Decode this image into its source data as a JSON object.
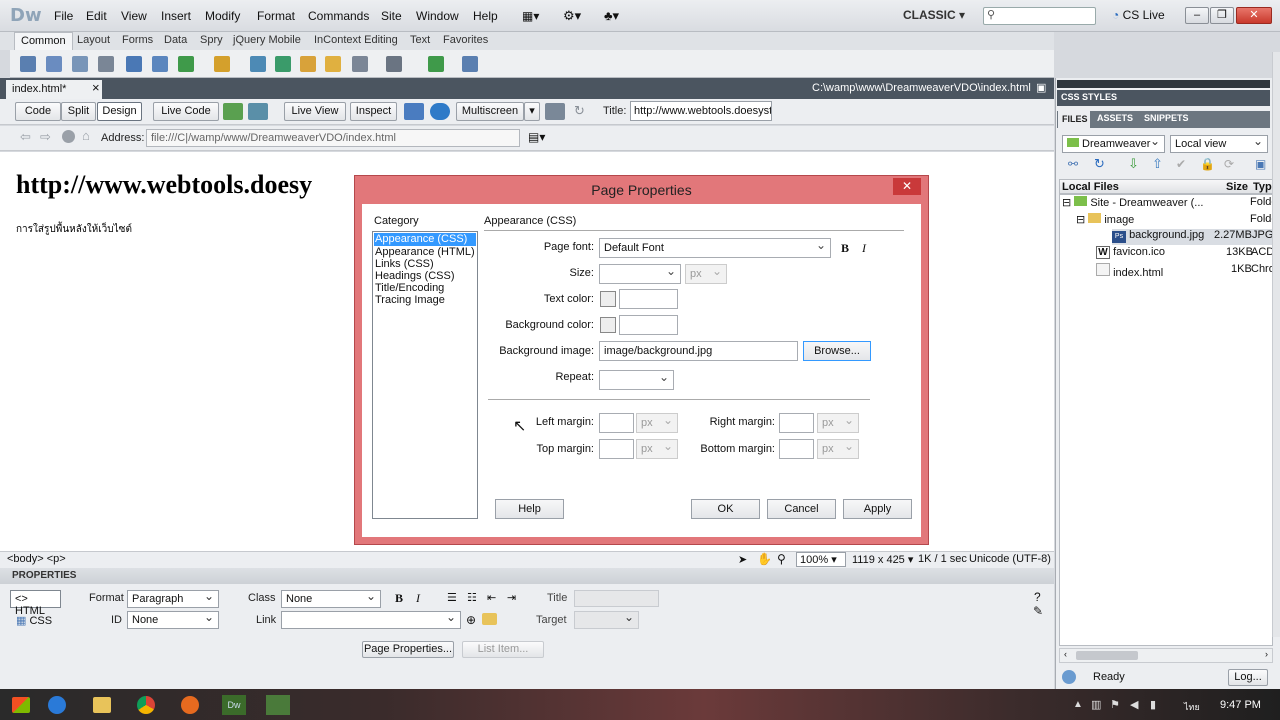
{
  "app": {
    "logo": "Dw",
    "menus": [
      "File",
      "Edit",
      "View",
      "Insert",
      "Modify",
      "Format",
      "Commands",
      "Site",
      "Window",
      "Help"
    ],
    "workspace": "CLASSIC",
    "cslive": "CS Live",
    "win_min": "–",
    "win_max": "❐",
    "win_close": "✕"
  },
  "insert_tabs": [
    "Common",
    "Layout",
    "Forms",
    "Data",
    "Spry",
    "jQuery Mobile",
    "InContext Editing",
    "Text",
    "Favorites"
  ],
  "document": {
    "tab": "index.html*",
    "tab_close": "×",
    "path": "C:\\wamp\\www\\DreamweaverVDO\\index.html",
    "view_buttons": {
      "code": "Code",
      "split": "Split",
      "design": "Design",
      "live_code": "Live Code",
      "live_view": "Live View",
      "inspect": "Inspect",
      "multiscreen": "Multiscreen"
    },
    "title_label": "Title:",
    "title_value": "http://www.webtools.doesyst",
    "address_label": "Address:",
    "address_value": "file:///C|/wamp/www/DreamweaverVDO/index.html"
  },
  "canvas": {
    "heading": "http://www.webtools.doesy",
    "text": "การใส่รูปพื้นหลังให้เว็บไซต์"
  },
  "status": {
    "tag": "<body> <p>",
    "zoom": "100%",
    "size": "1119 x 425",
    "dl": "1K / 1 sec",
    "encoding": "Unicode (UTF-8)"
  },
  "properties": {
    "header": "PROPERTIES",
    "html": "HTML",
    "css": "CSS",
    "format_label": "Format",
    "format_value": "Paragraph",
    "class_label": "Class",
    "class_value": "None",
    "id_label": "ID",
    "id_value": "None",
    "link_label": "Link",
    "title_label": "Title",
    "target_label": "Target",
    "bold": "B",
    "italic": "I",
    "page_props_btn": "Page Properties...",
    "list_item_btn": "List Item..."
  },
  "right_panel": {
    "css_styles": "CSS STYLES",
    "tabs": [
      "FILES",
      "ASSETS",
      "SNIPPETS"
    ],
    "site": "Dreamweaver",
    "view": "Local view",
    "col_local": "Local Files",
    "col_size": "Size",
    "col_type": "Typ",
    "files": [
      {
        "name": "Site - Dreamweaver (...",
        "size": "",
        "type": "Folde"
      },
      {
        "name": "image",
        "size": "",
        "type": "Folde"
      },
      {
        "name": "background.jpg",
        "size": "2.27MB",
        "type": "JPG I"
      },
      {
        "name": "favicon.ico",
        "size": "13KB",
        "type": "ACD:"
      },
      {
        "name": "index.html",
        "size": "1KB",
        "type": "Chro"
      }
    ],
    "ready": "Ready",
    "log": "Log..."
  },
  "taskbar": {
    "time": "9:47 PM",
    "lang": "ไทย"
  },
  "dialog": {
    "title": "Page Properties",
    "close": "✕",
    "category_label": "Category",
    "categories": [
      "Appearance (CSS)",
      "Appearance (HTML)",
      "Links (CSS)",
      "Headings (CSS)",
      "Title/Encoding",
      "Tracing Image"
    ],
    "section": "Appearance (CSS)",
    "page_font_label": "Page font:",
    "page_font_value": "Default Font",
    "bold": "B",
    "italic": "I",
    "size_label": "Size:",
    "unit_px": "px",
    "text_color_label": "Text color:",
    "bg_color_label": "Background color:",
    "bg_image_label": "Background image:",
    "bg_image_value": "image/background.jpg",
    "browse": "Browse...",
    "repeat_label": "Repeat:",
    "left_margin_label": "Left margin:",
    "right_margin_label": "Right margin:",
    "top_margin_label": "Top margin:",
    "bottom_margin_label": "Bottom margin:",
    "help": "Help",
    "ok": "OK",
    "cancel": "Cancel",
    "apply": "Apply"
  }
}
